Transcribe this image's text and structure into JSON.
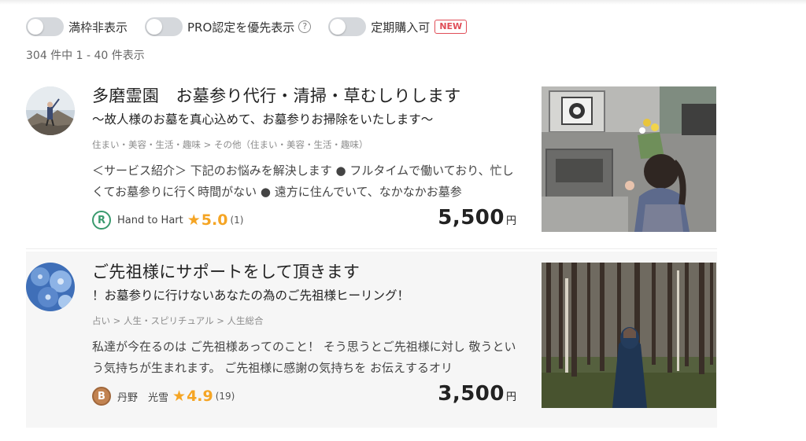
{
  "filters": [
    {
      "label": "満枠非表示",
      "checked": false
    },
    {
      "label": "PRO認定を優先表示",
      "checked": false,
      "help_icon": "?"
    },
    {
      "label": "定期購入可",
      "checked": false,
      "badge": "NEW"
    }
  ],
  "result_count": "304 件中 1 - 40 件表示",
  "colors": {
    "accent_new": "#e04d57",
    "star": "#f5a524",
    "rank_regular": "#3a9a6e",
    "rank_bronze": "#c28351"
  },
  "listings": [
    {
      "title": "多磨霊園　お墓参り代行・清掃・草むしりします",
      "subtitle": "〜故人様のお墓を真心込めて、お墓参りお掃除をいたします〜",
      "category": "住まい・美容・生活・趣味 > その他（住まい・美容・生活・趣味）",
      "description": "＜サービス紹介＞ 下記のお悩みを解決します ● フルタイムで働いており、忙しくてお墓参りに行く時間がない ● 遠方に住んでいて、なかなかお墓参",
      "seller_rank": "R",
      "seller_name": "Hand to Hart",
      "rating": "5.0",
      "review_count": "(1)",
      "price": "5,500",
      "price_unit": "円",
      "avatar_icon": "person-on-mountain-photo",
      "thumbnail_icon": "child-at-grave-photo"
    },
    {
      "title": "ご先祖様にサポートをして頂きます",
      "subtitle": "！お墓参りに行けないあなたの為のご先祖様ヒーリング！",
      "category": "占い > 人生・スピリチュアル > 人生総合",
      "description": "私達が今在るのは ご先祖様あってのこと！ そう思うとご先祖様に対し 敬うという気持ちが生まれます。 ご先祖様に感謝の気持ちを お伝えするオリ",
      "seller_rank": "B",
      "seller_name": "丹野　光雪",
      "rating": "4.9",
      "review_count": "(19)",
      "price": "3,500",
      "price_unit": "円",
      "avatar_icon": "blue-flower-photo",
      "thumbnail_icon": "person-in-forest-photo"
    }
  ]
}
